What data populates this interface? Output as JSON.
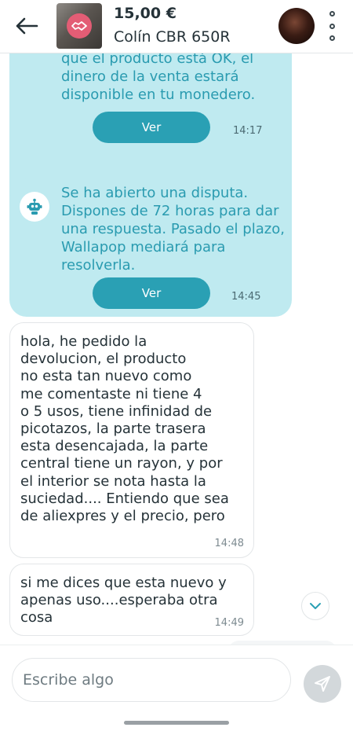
{
  "header": {
    "back_icon": "arrow-left-icon",
    "price": "15,00 €",
    "item_title": "Colín CBR 650R",
    "menu_icon": "kebab-menu-icon"
  },
  "chat": {
    "system_messages": [
      {
        "icon": "robot-icon",
        "text": "cuando el comprador confirme que el producto está OK, el dinero de la venta estará disponible en tu monedero.",
        "button_label": "Ver",
        "time": "14:17"
      },
      {
        "icon": "robot-icon",
        "text": "Se ha abierto una disputa. Dispones de 72 horas para dar una respuesta. Pasado el plazo, Wallapop mediará para resolverla.",
        "button_label": "Ver",
        "time": "14:45"
      }
    ],
    "messages": [
      {
        "text": "hola, he pedido la\ndevolucion, el producto\nno esta tan nuevo como\nme comentaste ni tiene 4\no 5 usos, tiene infinidad de\npicotazos, la parte trasera\nesta desencajada, la parte\ncentral tiene un rayon, y por\nel interior se nota hasta la\nsuciedad.... Entiendo que sea\nde aliexpres y el precio, pero",
        "time": "14:48"
      },
      {
        "text": "si me dices que esta nuevo y\napenas uso....esperaba otra\ncosa",
        "time": "14:49"
      }
    ]
  },
  "composer": {
    "placeholder": "Escribe algo",
    "send_icon": "send-icon"
  },
  "colors": {
    "system_bubble": "#bfeaf0",
    "system_text": "#2a9bb0",
    "button": "#2aa0b4",
    "text": "#253238"
  }
}
